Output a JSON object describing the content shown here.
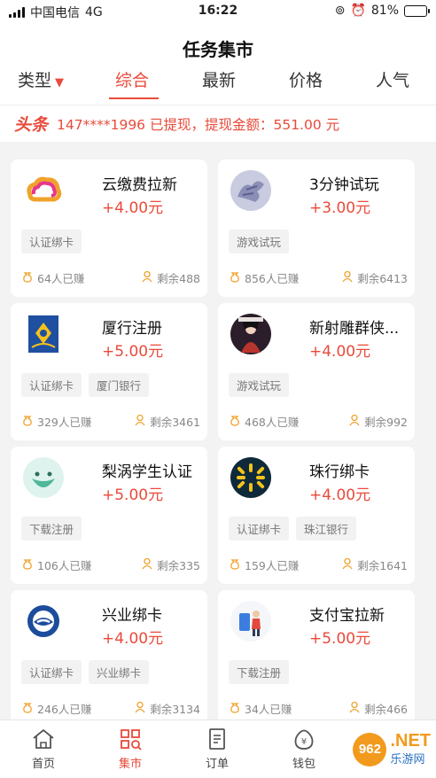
{
  "status": {
    "carrier": "中国电信",
    "network": "4G",
    "time": "16:22",
    "battery": "81%",
    "battery_level": 0.81
  },
  "header": {
    "title": "任务集市"
  },
  "tabs": [
    {
      "label": "类型",
      "caret": "▼"
    },
    {
      "label": "综合"
    },
    {
      "label": "最新"
    },
    {
      "label": "价格"
    },
    {
      "label": "人气"
    }
  ],
  "ticker": {
    "tag": "头条",
    "text": "147****1996 已提现，提现金额：551.00 元"
  },
  "cards": [
    {
      "name": "云缴费拉新",
      "price": "+4.00元",
      "tags": [
        "认证绑卡"
      ],
      "earned": "64人已赚",
      "remaining": "剩余488",
      "icon": "cloud-payment-icon"
    },
    {
      "name": "3分钟试玩",
      "price": "+3.00元",
      "tags": [
        "游戏试玩"
      ],
      "earned": "856人已赚",
      "remaining": "剩余6413",
      "icon": "dragon-game-icon"
    },
    {
      "name": "厦行注册",
      "price": "+5.00元",
      "tags": [
        "认证绑卡",
        "厦门银行"
      ],
      "earned": "329人已赚",
      "remaining": "剩余3461",
      "icon": "xiamen-bank-icon"
    },
    {
      "name": "新射雕群侠...",
      "price": "+4.00元",
      "tags": [
        "游戏试玩"
      ],
      "earned": "468人已赚",
      "remaining": "剩余992",
      "icon": "warrior-game-icon"
    },
    {
      "name": "梨涡学生认证",
      "price": "+5.00元",
      "tags": [
        "下载注册"
      ],
      "earned": "106人已赚",
      "remaining": "剩余335",
      "icon": "liwo-smile-icon"
    },
    {
      "name": "珠行绑卡",
      "price": "+4.00元",
      "tags": [
        "认证绑卡",
        "珠江银行"
      ],
      "earned": "159人已赚",
      "remaining": "剩余1641",
      "icon": "zhujiang-bank-icon"
    },
    {
      "name": "兴业绑卡",
      "price": "+4.00元",
      "tags": [
        "认证绑卡",
        "兴业绑卡"
      ],
      "earned": "246人已赚",
      "remaining": "剩余3134",
      "icon": "industrial-bank-icon"
    },
    {
      "name": "支付宝拉新",
      "price": "+5.00元",
      "tags": [
        "下载注册"
      ],
      "earned": "34人已赚",
      "remaining": "剩余466",
      "icon": "alipay-figure-icon"
    }
  ],
  "tabbar": [
    {
      "label": "首页",
      "icon": "home-icon"
    },
    {
      "label": "集市",
      "icon": "market-grid-icon"
    },
    {
      "label": "订单",
      "icon": "order-doc-icon"
    },
    {
      "label": "钱包",
      "icon": "wallet-icon"
    }
  ],
  "watermark": {
    "circle": "962",
    "text": ".NET",
    "sub": "乐游网"
  },
  "colors": {
    "accent": "#e94a3a",
    "background": "#f3f3f3"
  }
}
